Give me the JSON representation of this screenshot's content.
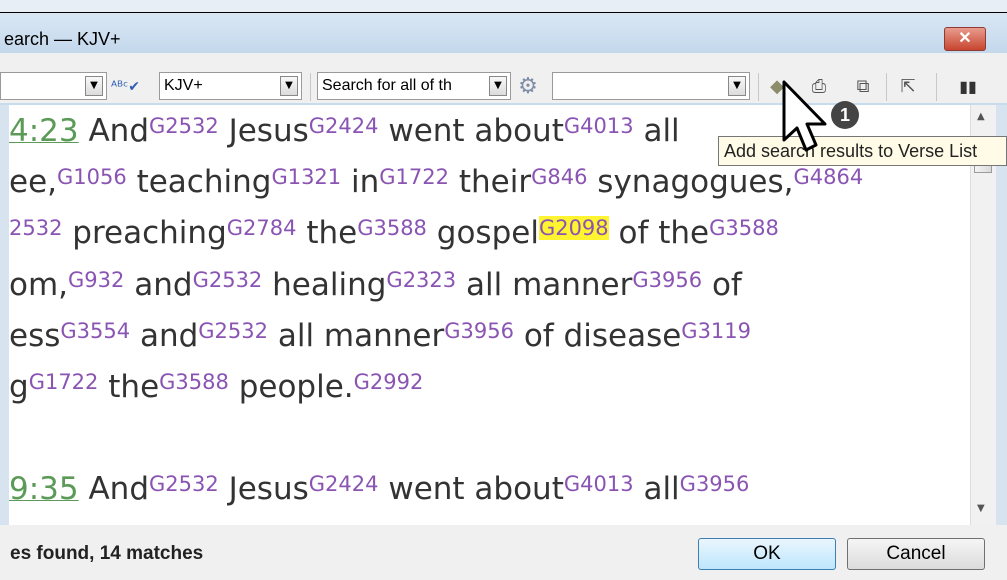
{
  "window": {
    "title": "earch — KJV+",
    "close_label": "✕"
  },
  "toolbar": {
    "combo1_value": "",
    "version_value": "KJV+",
    "search_mode_value": "Search for all of th",
    "query_value": "",
    "tooltip": "Add search results to Verse List"
  },
  "content": {
    "verse1_ref": "4:23",
    "verse2_ref": "9:35",
    "lines": [
      [
        {
          "ref": "4:23"
        },
        {
          "t": " And"
        },
        {
          "s": "G2532"
        },
        {
          "t": " Jesus"
        },
        {
          "s": "G2424"
        },
        {
          "t": " went about"
        },
        {
          "s": "G4013"
        },
        {
          "t": " all"
        }
      ],
      [
        {
          "t": "ee,"
        },
        {
          "s": "G1056"
        },
        {
          "t": " teaching"
        },
        {
          "s": "G1321"
        },
        {
          "t": " in"
        },
        {
          "s": "G1722"
        },
        {
          "t": " their"
        },
        {
          "s": "G846"
        },
        {
          "t": " synagogues,"
        },
        {
          "s": "G4864"
        }
      ],
      [
        {
          "s": "2532"
        },
        {
          "t": " preaching"
        },
        {
          "s": "G2784"
        },
        {
          "t": " the"
        },
        {
          "s": "G3588"
        },
        {
          "t": " gospel"
        },
        {
          "h": "G2098"
        },
        {
          "t": " of the"
        },
        {
          "s": "G3588"
        }
      ],
      [
        {
          "t": "om,"
        },
        {
          "s": "G932"
        },
        {
          "t": " and"
        },
        {
          "s": "G2532"
        },
        {
          "t": " healing"
        },
        {
          "s": "G2323"
        },
        {
          "t": " all manner"
        },
        {
          "s": "G3956"
        },
        {
          "t": " of"
        }
      ],
      [
        {
          "t": "ess"
        },
        {
          "s": "G3554"
        },
        {
          "t": " and"
        },
        {
          "s": "G2532"
        },
        {
          "t": " all manner"
        },
        {
          "s": "G3956"
        },
        {
          "t": " of disease"
        },
        {
          "s": "G3119"
        }
      ],
      [
        {
          "t": "g"
        },
        {
          "s": "G1722"
        },
        {
          "t": " the"
        },
        {
          "s": "G3588"
        },
        {
          "t": " people."
        },
        {
          "s": "G2992"
        }
      ],
      [],
      [
        {
          "ref": "9:35"
        },
        {
          "t": " And"
        },
        {
          "s": "G2532"
        },
        {
          "t": " Jesus"
        },
        {
          "s": "G2424"
        },
        {
          "t": " went about"
        },
        {
          "s": "G4013"
        },
        {
          "t": " all"
        },
        {
          "s": "G3956"
        }
      ]
    ]
  },
  "status": {
    "text": "es found, 14 matches"
  },
  "buttons": {
    "ok": "OK",
    "cancel": "Cancel"
  },
  "callout": {
    "number": "1"
  },
  "colors": {
    "strongs": "#8a54b3",
    "reference": "#5b9a57",
    "highlight": "#fff430"
  }
}
